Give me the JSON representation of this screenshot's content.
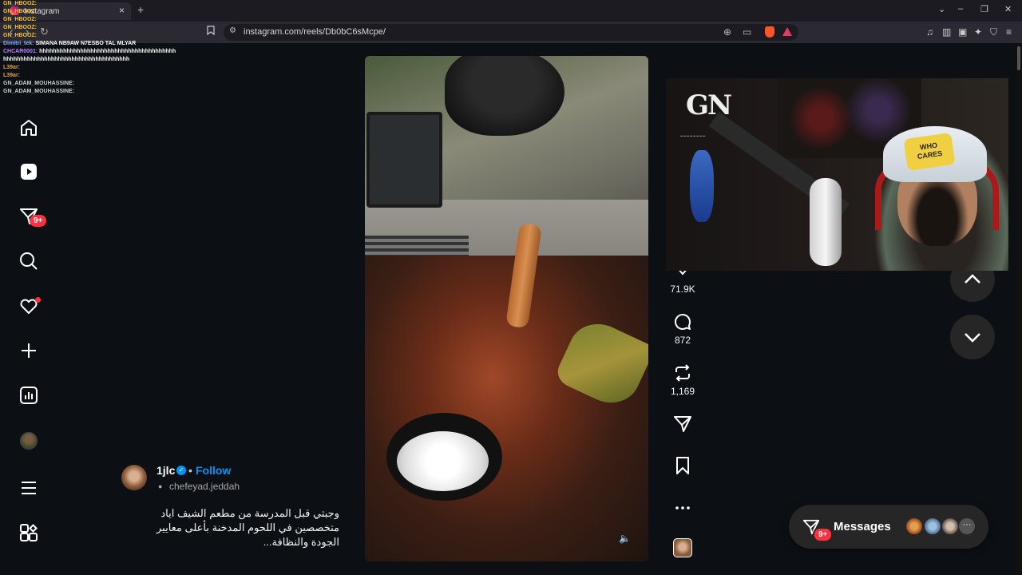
{
  "browser": {
    "tab_title": "Instagram",
    "tab_close": "×",
    "new_tab": "+",
    "url": "instagram.com/reels/Db0bC6sMcpe/",
    "window_controls": [
      "⌄",
      "–",
      "❐",
      "✕"
    ]
  },
  "chat": [
    {
      "user": "GN_HBOOZ:",
      "msg": "",
      "color": "gold"
    },
    {
      "user": "GN_HBOOZ:",
      "msg": "",
      "color": "gold"
    },
    {
      "user": "GN_HBOOZ:",
      "msg": "",
      "color": "gold"
    },
    {
      "user": "GN_HBOOZ:",
      "msg": "",
      "color": "gold"
    },
    {
      "user": "GN_HBOOZ:",
      "msg": "",
      "color": "gold"
    },
    {
      "user": "Dimitri_tek:",
      "msg": "SIMANA NB9AW N7ESBO TAL MLYAR",
      "color": "blue"
    },
    {
      "user": "",
      "msg": "",
      "color": "gold"
    },
    {
      "user": "CHCAR0001:",
      "msg": "hhhhhhhhhhhhhhhhhhhhhhhhhhhhhhhhhhhhhhhh",
      "color": "purp"
    },
    {
      "user": "",
      "msg": "hhhhhhhhhhhhhhhhhhhhhhhhhhhhhhhhhhhhh",
      "color": "grey"
    },
    {
      "user": "L39ar:",
      "msg": "",
      "color": "orng"
    },
    {
      "user": "L39ar:",
      "msg": "",
      "color": "orng"
    },
    {
      "user": "GN_ADAM_MOUHASSINE:",
      "msg": "",
      "color": "grey"
    },
    {
      "user": "GN_ADAM_MOUHASSINE:",
      "msg": "",
      "color": "grey"
    }
  ],
  "sidebar": {
    "items": [
      {
        "name": "home-icon"
      },
      {
        "name": "reels-icon"
      },
      {
        "name": "direct-icon",
        "badge": "9+"
      },
      {
        "name": "search-icon"
      },
      {
        "name": "notifications-icon"
      },
      {
        "name": "create-icon"
      },
      {
        "name": "dashboard-icon"
      },
      {
        "name": "profile-avatar"
      },
      {
        "name": "menu-icon"
      },
      {
        "name": "also-from-meta-icon"
      }
    ],
    "direct_badge": "9+"
  },
  "reel": {
    "author": "1jlc",
    "follow": "Follow",
    "separator": "•",
    "collab": "chefeyad.jeddah",
    "caption_lines": [
      "وجبتي قبل المدرسة من مطعم الشيف اياد",
      "متخصصين في اللحوم المدخنة بأعلى معايير",
      "الجودة والنظافة..."
    ],
    "volume_icon": "🔈"
  },
  "actions": {
    "likes": "71.9K",
    "comments": "872",
    "reposts": "1,169"
  },
  "webcam": {
    "logo": "GN",
    "cap_text_1": "WHO",
    "cap_text_2": "CARES"
  },
  "messages": {
    "label": "Messages",
    "badge": "9+",
    "more": "···"
  },
  "colors": {
    "accent": "#0095f6",
    "badge": "#ff3040",
    "background": "#0c1014"
  }
}
